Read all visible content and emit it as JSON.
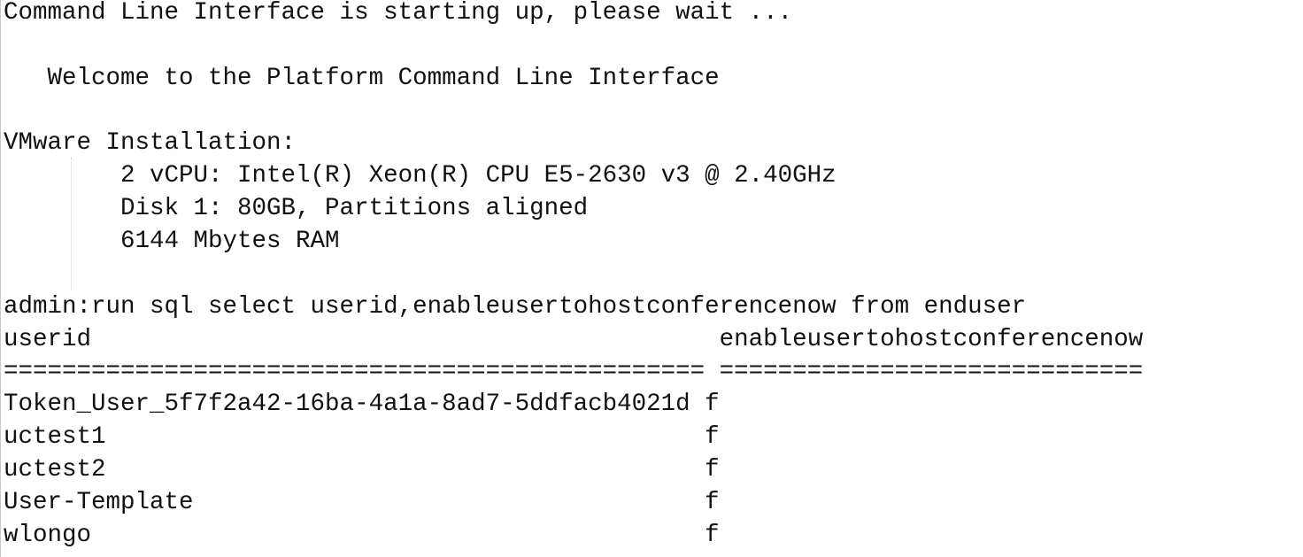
{
  "terminal": {
    "lines": [
      "Command Line Interface is starting up, please wait ...",
      "",
      "   Welcome to the Platform Command Line Interface",
      "",
      "VMware Installation:",
      "        2 vCPU: Intel(R) Xeon(R) CPU E5-2630 v3 @ 2.40GHz",
      "        Disk 1: 80GB, Partitions aligned",
      "        6144 Mbytes RAM",
      "",
      "admin:run sql select userid,enableusertohostconferencenow from enduser",
      "userid                                           enableusertohostconferencenow",
      "================================================ =============================",
      "Token_User_5f7f2a42-16ba-4a1a-8ad7-5ddfacb4021d f",
      "uctest1                                         f",
      "uctest2                                         f",
      "User-Template                                   f",
      "wlongo                                          f"
    ]
  }
}
